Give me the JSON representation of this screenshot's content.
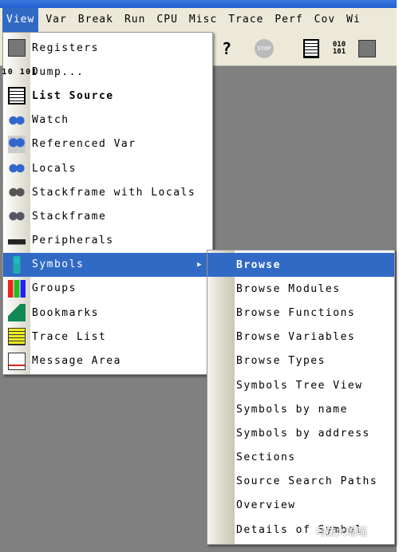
{
  "menubar": {
    "items": [
      "View",
      "Var",
      "Break",
      "Run",
      "CPU",
      "Misc",
      "Trace",
      "Perf",
      "Cov",
      "Wi"
    ],
    "active": "View"
  },
  "toolbar": {
    "icons": [
      "whats-this-icon",
      "stop-icon",
      "list-source-icon",
      "dump-icon",
      "registers-icon"
    ],
    "whats_this": "?",
    "stop": "STOP",
    "dump": "010 101"
  },
  "view_menu": {
    "items": [
      {
        "label": "Registers",
        "icon": "registers-icon"
      },
      {
        "label": "Dump...",
        "icon": "dump-icon"
      },
      {
        "label": "List Source",
        "icon": "list-source-icon",
        "bold": true
      },
      {
        "label": "Watch",
        "icon": "watch-icon"
      },
      {
        "label": "Referenced Var",
        "icon": "referenced-var-icon"
      },
      {
        "label": "Locals",
        "icon": "locals-icon"
      },
      {
        "label": "Stackframe with Locals",
        "icon": "stackframe-locals-icon"
      },
      {
        "label": "Stackframe",
        "icon": "stackframe-icon"
      },
      {
        "label": "Peripherals",
        "icon": "peripherals-icon"
      },
      {
        "label": "Symbols",
        "icon": "symbols-icon",
        "highlighted": true,
        "submenu": true
      },
      {
        "label": "Groups",
        "icon": "groups-icon"
      },
      {
        "label": "Bookmarks",
        "icon": "bookmarks-icon"
      },
      {
        "label": "Trace List",
        "icon": "trace-list-icon"
      },
      {
        "label": "Message Area",
        "icon": "message-area-icon"
      }
    ]
  },
  "symbols_submenu": {
    "items": [
      {
        "label": "Browse",
        "bold": true,
        "highlighted": true
      },
      {
        "label": "Browse Modules"
      },
      {
        "label": "Browse Functions"
      },
      {
        "label": "Browse Variables"
      },
      {
        "label": "Browse Types"
      },
      {
        "label": "Symbols Tree View"
      },
      {
        "label": "Symbols by name"
      },
      {
        "label": "Symbols by address"
      },
      {
        "label": "Sections"
      },
      {
        "label": "Source Search Paths"
      },
      {
        "label": "Overview"
      },
      {
        "label": "Details of Symbol"
      }
    ]
  },
  "watermark": "乌拉大喵喵",
  "colors": {
    "highlight": "#316ac5",
    "menubar": "#ece9d8",
    "workspace": "#808080"
  }
}
